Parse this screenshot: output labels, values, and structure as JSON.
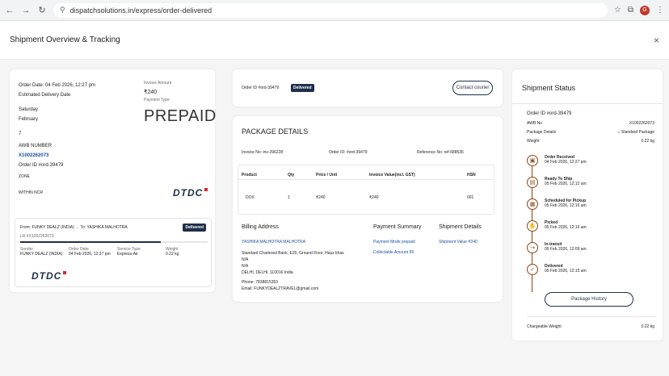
{
  "browser": {
    "url": "dispatchsolutions.in/express/order-delivered",
    "avatar_letter": "G"
  },
  "modal": {
    "title": "Shipment Overview & Tracking"
  },
  "left": {
    "order_date": "Order Date: 04 Feb 2026, 12:27 pm",
    "estimated_label": "Estimated Delivery Date",
    "day": "Saturday",
    "month": "February",
    "date_num": "7",
    "awb_label": "AWB NUMBER",
    "awb": "X1002262073",
    "order_id": "Order ID #ord-39479",
    "invoice_amount_label": "Invoice Amount",
    "invoice_amount": "₹240",
    "payment_type_label": "Payment Type",
    "payment_type": "PREPAID",
    "zone_label": "ZONE",
    "zone": "WITHIN NCR",
    "courier_logo": "DTDC",
    "label": {
      "route": "From: FUNKY DEALZ (INDIA) → To: YASHIKA MALHOTRA",
      "status": "Delivered",
      "lr": "LR #X1002262073",
      "progress": 0.75,
      "sender_label": "Sender",
      "sender": "FUNKY DEALZ (INDIA)",
      "order_date_label": "Order Date",
      "order_date": "04 Feb 2026, 12:27 pm",
      "service_label": "Service Type",
      "service": "Express-Air",
      "weight_label": "Weight",
      "weight": "0.22 kg"
    }
  },
  "middle": {
    "order_id": "Order ID #ord-39479",
    "status": "Delivered",
    "contact_button": "Contact courier",
    "package_title": "PACKAGE DETAILS",
    "invoice_no": "Invoice No: inv-296228",
    "order_id2": "Order ID: #ord-39479",
    "reference": "Reference No: ref-688535",
    "table": {
      "headers": [
        "Product",
        "Qty",
        "Price / Unit",
        "Invoice Value(incl. GST)",
        "HSN"
      ],
      "row": [
        "DOX",
        "1",
        "₹240",
        "₹240",
        "001"
      ]
    },
    "billing": {
      "title": "Billing Address",
      "name": "YASHIKA MALHOTRA MALHOTRA",
      "line1": "Standard Chartered Bank, E20, Ground Floor, Hauz khas",
      "line2": "N/A",
      "line3": "N/A",
      "line4": "DELHI, DELHI, 110016 India",
      "phone": "Phone: 7838815353",
      "email": "Email: FUNKYDEALZTRAVEL@gmail.com"
    },
    "payment": {
      "title": "Payment Summary",
      "mode": "Payment Mode prepaid",
      "collectable": "Collectable Amount ₹0"
    },
    "shipment": {
      "title": "Shipment Details",
      "value": "Shipment Value ₹240"
    }
  },
  "status": {
    "title": "Shipment Status",
    "order_id": "Order ID #ord-39479",
    "awb_label": "AWB No",
    "awb": "X1002262073",
    "pkg_label": "Package Details",
    "pkg": "Standard Package",
    "weight_label": "Weight",
    "weight": "0.22 kg",
    "events": [
      {
        "title": "Order Received",
        "time": "04 Feb 2026, 12:27 pm",
        "icon": "cart-icon"
      },
      {
        "title": "Ready To Ship",
        "time": "05 Feb 2026, 12:12 am",
        "icon": "box-icon"
      },
      {
        "title": "Scheduled for Pickup",
        "time": "05 Feb 2026, 12:16 am",
        "icon": "calendar-icon"
      },
      {
        "title": "Picked",
        "time": "05 Feb 2026, 12:16 am",
        "icon": "hand-icon"
      },
      {
        "title": "In-transit",
        "time": "05 Feb 2026, 12:09 am",
        "icon": "truck-icon"
      },
      {
        "title": "Delivered",
        "time": "05 Feb 2026, 12:15 am",
        "icon": "check-icon"
      }
    ],
    "history_button": "Package History",
    "chargeable_label": "Chargeable Weight",
    "chargeable": "0.22 kg"
  }
}
